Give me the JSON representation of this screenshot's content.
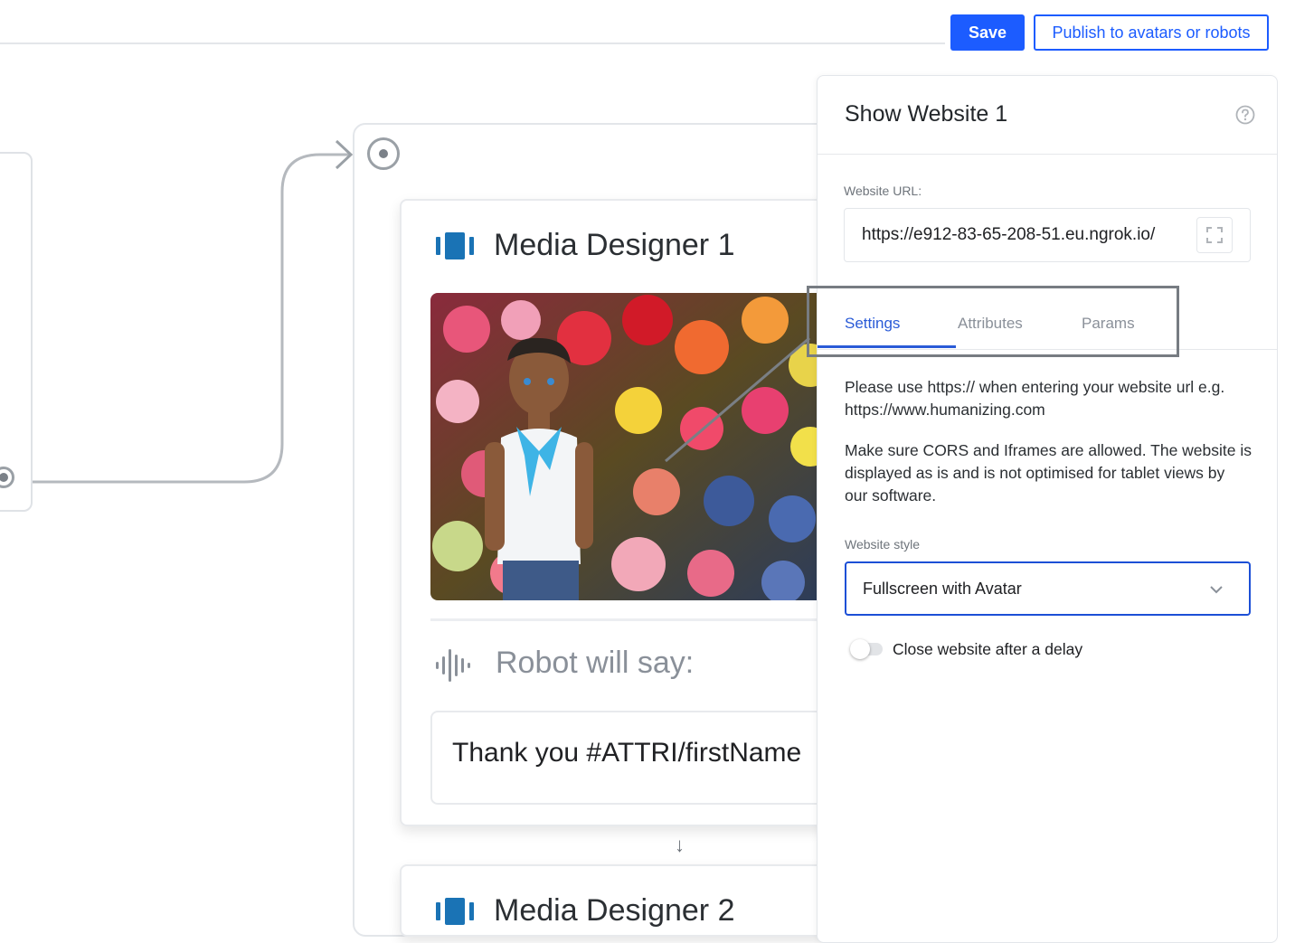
{
  "toolbar": {
    "save_label": "Save",
    "publish_label": "Publish to avatars or robots"
  },
  "canvas": {
    "nodes": [
      {
        "title": "Media Designer 1",
        "image_description": "Avatar character standing in front of colorful flowers",
        "robot_label": "Robot will say:",
        "speech": "Thank you #ATTRI/firstName"
      },
      {
        "title": "Media Designer 2"
      }
    ]
  },
  "panel": {
    "title": "Show Website 1",
    "url_label": "Website URL:",
    "url_value": "https://e912-83-65-208-51.eu.ngrok.io/",
    "tabs": [
      {
        "label": "Settings",
        "active": true
      },
      {
        "label": "Attributes",
        "active": false
      },
      {
        "label": "Params",
        "active": false
      }
    ],
    "help_text_1": "Please use https:// when entering your website url e.g. https://www.humanizing.com",
    "help_text_2": "Make sure CORS and Iframes are allowed. The website is displayed as is and is not optimised for tablet views by our software.",
    "style_label": "Website style",
    "style_value": "Fullscreen with Avatar",
    "toggle_label": "Close website after a delay",
    "toggle_on": false
  },
  "colors": {
    "primary": "#1c5cff",
    "tab_active": "#2a5bd7",
    "media_icon": "#1a73b5"
  },
  "icons": [
    "media-icon",
    "sound-wave-icon",
    "help-icon",
    "expand-icon",
    "chevron-down-icon",
    "start-port-icon"
  ]
}
